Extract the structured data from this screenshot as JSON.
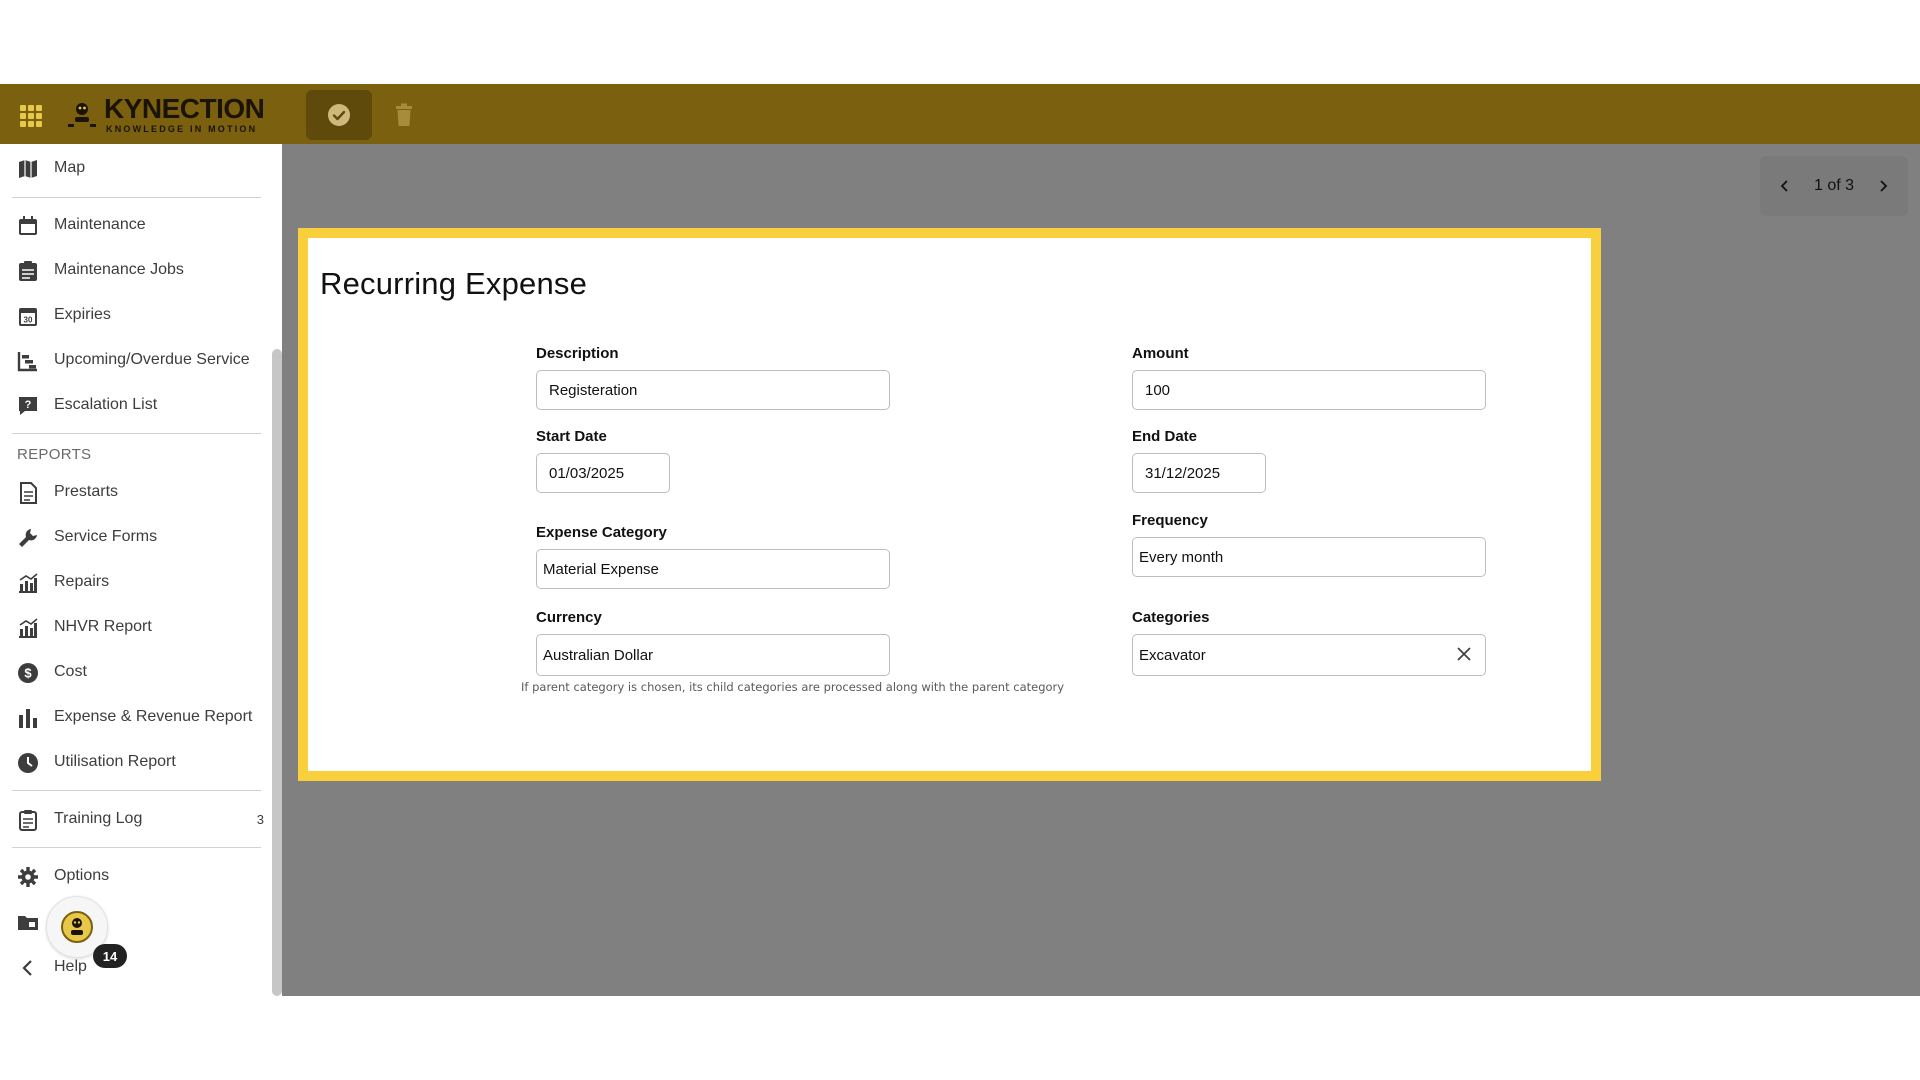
{
  "brand": {
    "name": "KYNECTION",
    "tagline": "KNOWLEDGE IN MOTION"
  },
  "sidebar": {
    "items": [
      {
        "label": "Map",
        "icon": "map-icon"
      },
      {
        "label": "Maintenance",
        "icon": "calendar-icon"
      },
      {
        "label": "Maintenance Jobs",
        "icon": "clipboard-list-icon"
      },
      {
        "label": "Expiries",
        "icon": "calendar-30-icon"
      },
      {
        "label": "Upcoming/Overdue Service",
        "icon": "gantt-icon"
      },
      {
        "label": "Escalation List",
        "icon": "question-message-icon"
      }
    ],
    "reports_title": "REPORTS",
    "reports": [
      {
        "label": "Prestarts",
        "icon": "document-icon"
      },
      {
        "label": "Service Forms",
        "icon": "wrench-icon"
      },
      {
        "label": "Repairs",
        "icon": "chart-icon"
      },
      {
        "label": "NHVR Report",
        "icon": "chart-icon"
      },
      {
        "label": "Cost",
        "icon": "dollar-icon"
      },
      {
        "label": "Expense & Revenue Report",
        "icon": "bar-chart-icon"
      },
      {
        "label": "Utilisation Report",
        "icon": "clock-icon"
      }
    ],
    "training": {
      "label": "Training Log",
      "badge": "3",
      "icon": "clipboard-icon"
    },
    "options": {
      "label": "Options",
      "icon": "gear-icon"
    },
    "help": {
      "label": "Help",
      "icon": "chevron-left-icon"
    },
    "notification_count": "14"
  },
  "pager": {
    "text": "1 of 3"
  },
  "form": {
    "title": "Recurring Expense",
    "description": {
      "label": "Description",
      "value": "Registeration"
    },
    "amount": {
      "label": "Amount",
      "value": "100"
    },
    "start_date": {
      "label": "Start Date",
      "value": "01/03/2025"
    },
    "end_date": {
      "label": "End Date",
      "value": "31/12/2025"
    },
    "expense_category": {
      "label": "Expense Category",
      "value": "Material Expense"
    },
    "frequency": {
      "label": "Frequency",
      "value": "Every month"
    },
    "currency": {
      "label": "Currency",
      "value": "Australian Dollar"
    },
    "categories": {
      "label": "Categories",
      "value": "Excavator"
    },
    "hint": "If parent category is chosen, its child categories are processed along with the parent category"
  },
  "colors": {
    "topbar": "#7b6010",
    "highlight": "#f9cf3b",
    "content_bg": "#808080"
  }
}
